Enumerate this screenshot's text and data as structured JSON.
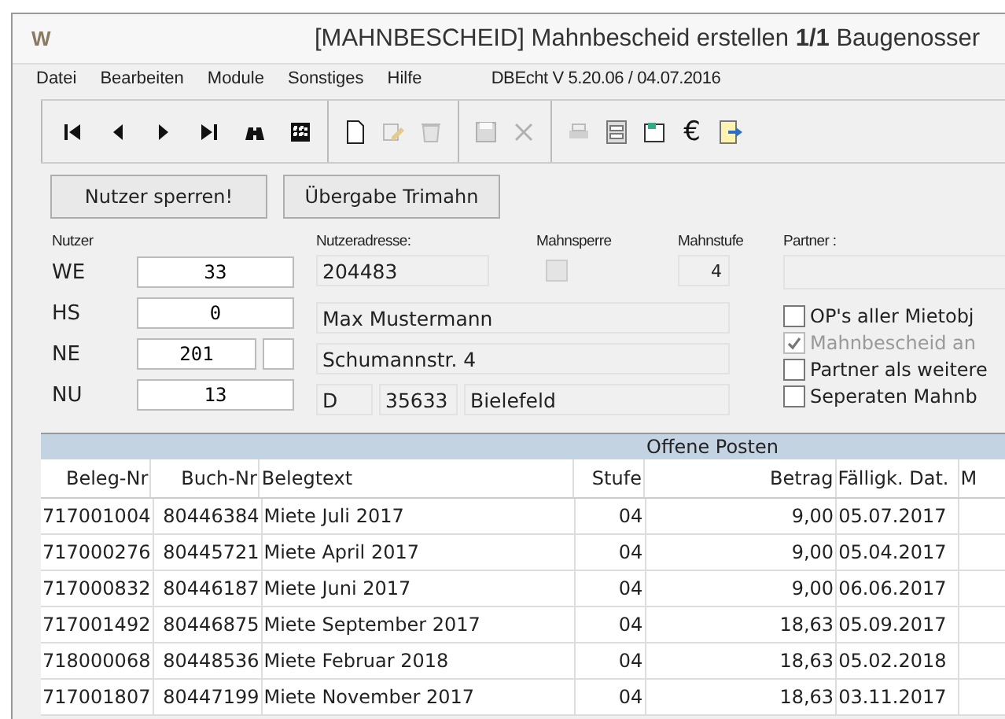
{
  "window": {
    "app_letter": "W",
    "title": "[MAHNBESCHEID] Mahnbescheid erstellen  **1/1** Baugenosser"
  },
  "menu": [
    "Datei",
    "Bearbeiten",
    "Module",
    "Sonstiges",
    "Hilfe"
  ],
  "version": "DBEcht V 5.20.06  /  04.07.2016",
  "toolbar": [
    [
      {
        "kind": "first",
        "disabled": false
      },
      {
        "kind": "prev",
        "disabled": false
      },
      {
        "kind": "next",
        "disabled": false
      },
      {
        "kind": "last",
        "disabled": false
      },
      {
        "kind": "binoculars",
        "disabled": false
      },
      {
        "kind": "grid",
        "disabled": false
      }
    ],
    [
      {
        "kind": "page",
        "disabled": false
      },
      {
        "kind": "edit",
        "disabled": true
      },
      {
        "kind": "trash",
        "disabled": true
      }
    ],
    [
      {
        "kind": "save",
        "disabled": true
      },
      {
        "kind": "cancel",
        "disabled": true
      }
    ],
    [
      {
        "kind": "print",
        "disabled": true
      },
      {
        "kind": "form",
        "disabled": false
      },
      {
        "kind": "card",
        "disabled": false
      },
      {
        "kind": "text",
        "label": "€",
        "disabled": false
      },
      {
        "kind": "export",
        "disabled": false
      }
    ]
  ],
  "buttons": [
    "Nutzer sperren!",
    "Übergabe Trimahn"
  ],
  "nutzer": {
    "label": "Nutzer",
    "rows": [
      {
        "label": "WE",
        "value": "33"
      },
      {
        "label": "HS",
        "value": "0"
      },
      {
        "label": "NE",
        "value": "201",
        "extra": true
      },
      {
        "label": "NU",
        "value": "13"
      }
    ]
  },
  "address": {
    "label": "Nutzeradresse:",
    "id": "204483",
    "name": "Max Mustermann",
    "street": "Schumannstr. 4",
    "country": "D",
    "zip": "35633",
    "city": "Bielefeld"
  },
  "mahnsperre": {
    "label": "Mahnsperre",
    "checked": false,
    "disabled": true
  },
  "mahnstufe": {
    "label": "Mahnstufe",
    "value": "4"
  },
  "partner": {
    "label": "Partner :"
  },
  "options": [
    {
      "label": "OP's aller Mietobj",
      "checked": false,
      "disabled": false
    },
    {
      "label": "Mahnbescheid an",
      "checked": true,
      "disabled": true
    },
    {
      "label": "Partner als weitere",
      "checked": false,
      "disabled": false
    },
    {
      "label": "Seperaten Mahnb",
      "checked": false,
      "disabled": false
    }
  ],
  "table": {
    "title": "Offene Posten",
    "columns": [
      "Beleg-Nr",
      "Buch-Nr",
      "Belegtext",
      "Stufe",
      "Betrag",
      "Fälligk. Dat.",
      "M"
    ],
    "rows": [
      [
        "717001004",
        "80446384",
        "Miete Juli 2017",
        "04",
        "9,00",
        "05.07.2017"
      ],
      [
        "717000276",
        "80445721",
        "Miete April 2017",
        "04",
        "9,00",
        "05.04.2017"
      ],
      [
        "717000832",
        "80446187",
        "Miete Juni 2017",
        "04",
        "9,00",
        "06.06.2017"
      ],
      [
        "717001492",
        "80446875",
        "Miete September 2017",
        "04",
        "18,63",
        "05.09.2017"
      ],
      [
        "718000068",
        "80448536",
        "Miete Februar 2018",
        "04",
        "18,63",
        "05.02.2018"
      ],
      [
        "717001807",
        "80447199",
        "Miete November 2017",
        "04",
        "18,63",
        "03.11.2017"
      ]
    ]
  }
}
